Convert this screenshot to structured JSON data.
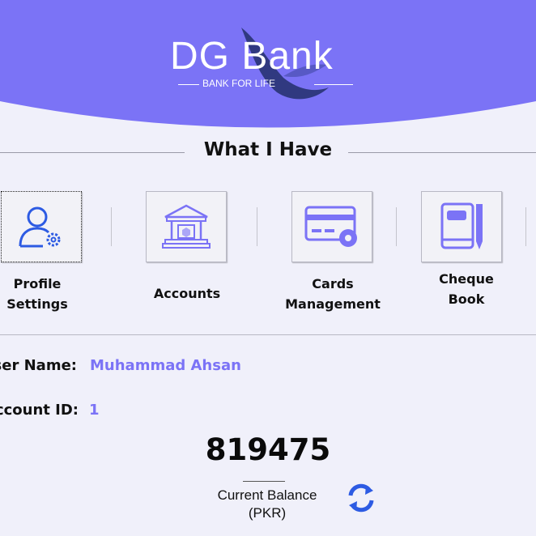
{
  "colors": {
    "accent": "#7b73f6",
    "header": "#7b73f6",
    "background": "#f0f0fa",
    "icon_blue": "#2d5be3"
  },
  "brand": {
    "name": "DG Bank",
    "tagline": "BANK FOR LIFE"
  },
  "section": {
    "title": "What I Have"
  },
  "tiles": [
    {
      "label_line1": "Profile",
      "label_line2": "Settings",
      "icon": "user-gear-icon"
    },
    {
      "label_line1": "Accounts",
      "label_line2": "",
      "icon": "bank-building-icon"
    },
    {
      "label_line1": "Cards",
      "label_line2": "Management",
      "icon": "card-gear-icon"
    },
    {
      "label_line1": "Cheque",
      "label_line2": "Book",
      "icon": "book-pen-icon"
    }
  ],
  "info": {
    "user_name_label": "User Name:",
    "user_name_value": "Muhammad Ahsan",
    "account_id_label": "Account ID:",
    "account_id_value": "1"
  },
  "balance": {
    "amount": "819475",
    "caption_line1": "Current Balance",
    "caption_line2": "(PKR)"
  },
  "refresh_icon": "refresh-icon"
}
